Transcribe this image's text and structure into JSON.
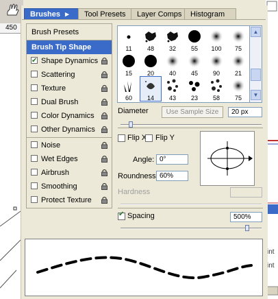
{
  "ruler": {
    "value": "450"
  },
  "tabs": [
    {
      "label": "Brushes",
      "arrow": "▸"
    },
    {
      "label": "Tool Presets"
    },
    {
      "label": "Layer Comps"
    },
    {
      "label": "Histogram"
    }
  ],
  "left_panel": {
    "header": "Brush Presets",
    "selected": "Brush Tip Shape",
    "options": [
      {
        "label": "Shape Dynamics",
        "checked": true
      },
      {
        "label": "Scattering",
        "checked": false
      },
      {
        "label": "Texture",
        "checked": false
      },
      {
        "label": "Dual Brush",
        "checked": false
      },
      {
        "label": "Color Dynamics",
        "checked": false
      },
      {
        "label": "Other Dynamics",
        "checked": false
      },
      {
        "label": "Noise",
        "checked": false
      },
      {
        "label": "Wet Edges",
        "checked": false
      },
      {
        "label": "Airbrush",
        "checked": false
      },
      {
        "label": "Smoothing",
        "checked": false
      },
      {
        "label": "Protect Texture",
        "checked": false
      }
    ]
  },
  "brush_grid": {
    "sizes": [
      "11",
      "48",
      "32",
      "55",
      "100",
      "75",
      "15",
      "20",
      "40",
      "45",
      "90",
      "21",
      "60",
      "14",
      "43",
      "23",
      "58",
      "75"
    ],
    "selected_index": 13
  },
  "diameter": {
    "label": "Diameter",
    "sample_button": "Use Sample Size",
    "value": "20 px"
  },
  "flip": {
    "x_label": "Flip X",
    "y_label": "Flip Y"
  },
  "angle": {
    "label": "Angle:",
    "value": "0°"
  },
  "roundness": {
    "label": "Roundness:",
    "value": "60%"
  },
  "hardness": {
    "label": "Hardness"
  },
  "spacing": {
    "label": "Spacing",
    "checked": true,
    "value": "500%"
  },
  "right_partial": {
    "line1": "int",
    "line2": "int"
  }
}
